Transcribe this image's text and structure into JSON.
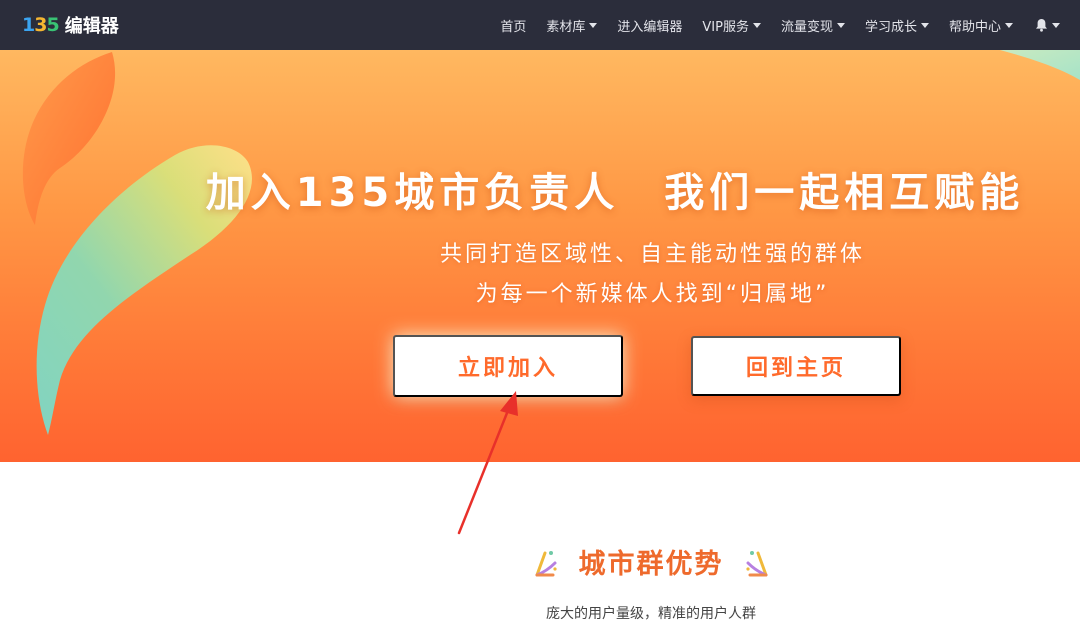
{
  "brand": {
    "mark": "135",
    "name": "编辑器"
  },
  "nav": {
    "items": [
      {
        "label": "首页",
        "dropdown": false
      },
      {
        "label": "素材库",
        "dropdown": true
      },
      {
        "label": "进入编辑器",
        "dropdown": false
      },
      {
        "label": "VIP服务",
        "dropdown": true
      },
      {
        "label": "流量变现",
        "dropdown": true
      },
      {
        "label": "学习成长",
        "dropdown": true
      },
      {
        "label": "帮助中心",
        "dropdown": true
      }
    ],
    "notification_icon": "bell-icon"
  },
  "hero": {
    "title": "加入135城市负责人　我们一起相互赋能",
    "subtitle_1": "共同打造区域性、自主能动性强的群体",
    "subtitle_2": "为每一个新媒体人找到“归属地”",
    "join_button": "立即加入",
    "home_button": "回到主页"
  },
  "section": {
    "title": "城市群优势",
    "description": "庞大的用户量级，精准的用户人群",
    "title_icon": "confetti-icon"
  },
  "colors": {
    "navbar": "#2b2d3b",
    "accent": "#ff6a2b",
    "hero_top": "#ffb860",
    "hero_bottom": "#ff6330",
    "section_title": "#ee6a2c",
    "annotation_arrow": "#e8302a"
  }
}
